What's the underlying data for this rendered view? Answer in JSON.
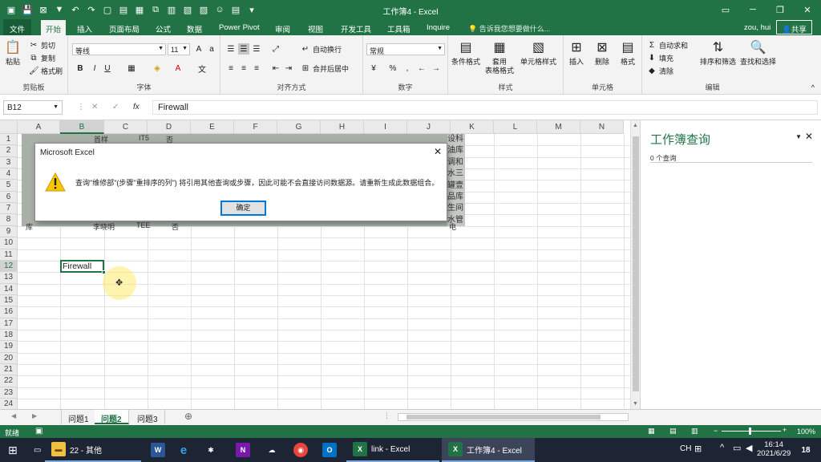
{
  "window": {
    "title": "工作簿4 - Excel",
    "controls": [
      "▭",
      "─",
      "❐",
      "✕"
    ]
  },
  "ribbon_tabs": [
    "文件",
    "开始",
    "插入",
    "页面布局",
    "公式",
    "数据",
    "Power Pivot",
    "审阅",
    "视图",
    "开发工具",
    "工具箱",
    "Inquire"
  ],
  "tell_me": "告诉我您想要做什么...",
  "user": "zou, hui",
  "share": "共享",
  "clipboard": {
    "paste": "粘贴",
    "cut": "剪切",
    "copy": "复制",
    "format_painter": "格式刷",
    "label": "剪贴板"
  },
  "font": {
    "name": "等线",
    "size": "11",
    "label": "字体"
  },
  "alignment": {
    "wrap": "自动换行",
    "merge": "合并后居中",
    "label": "对齐方式"
  },
  "number": {
    "format": "常规",
    "label": "数字"
  },
  "styles": {
    "conditional": "条件格式",
    "table": "套用\n表格格式",
    "cell_styles": "单元格样式",
    "label": "样式"
  },
  "cells": {
    "insert": "插入",
    "delete": "删除",
    "format": "格式",
    "label": "单元格"
  },
  "editing": {
    "autosum": "自动求和",
    "fill": "填充",
    "clear": "清除",
    "sort": "排序和筛选",
    "find": "查找和选择",
    "label": "编辑"
  },
  "formula_bar": {
    "name_box": "B12",
    "formula": "Firewall"
  },
  "columns": [
    "A",
    "B",
    "C",
    "D",
    "E",
    "F",
    "G",
    "H",
    "I",
    "J",
    "K",
    "L",
    "M",
    "N"
  ],
  "rows": [
    "1",
    "2",
    "3",
    "4",
    "5",
    "6",
    "7",
    "8",
    "9",
    "10",
    "11",
    "12",
    "13",
    "14",
    "15",
    "16",
    "17",
    "18",
    "19",
    "20",
    "21",
    "22",
    "23",
    "24"
  ],
  "cell_B12": "Firewall",
  "image_fragments": {
    "row1": [
      "首样",
      "IT5",
      "否"
    ],
    "row8": [
      "库",
      "李晓明",
      "TEE",
      "否"
    ],
    "right_col": [
      "设科",
      "油库",
      "调和",
      "水三",
      "罐壹",
      "品库",
      "生间",
      "水管",
      "电"
    ]
  },
  "dialog": {
    "title": "Microsoft Excel",
    "message": "查询\"维修部\"(步骤\"重排序的列\") 将引用其他查询或步骤，因此可能不会直接访问数据源。请重新生成此数据组合。",
    "ok": "确定"
  },
  "pane": {
    "title": "工作簿查询",
    "count": "0 个查询"
  },
  "sheets": [
    "问题1",
    "问题2",
    "问题3"
  ],
  "status": {
    "ready": "就绪",
    "zoom": "100%"
  },
  "taskbar": {
    "items": [
      {
        "label": "22 - 其他",
        "icon": "folder-icon"
      },
      {
        "label": "link - Excel",
        "icon": "excel-icon"
      },
      {
        "label": "工作簿4 - Excel",
        "icon": "excel-icon"
      }
    ],
    "lang": "CH",
    "time": "16:14",
    "date": "2021/6/29",
    "notifications": "18"
  }
}
